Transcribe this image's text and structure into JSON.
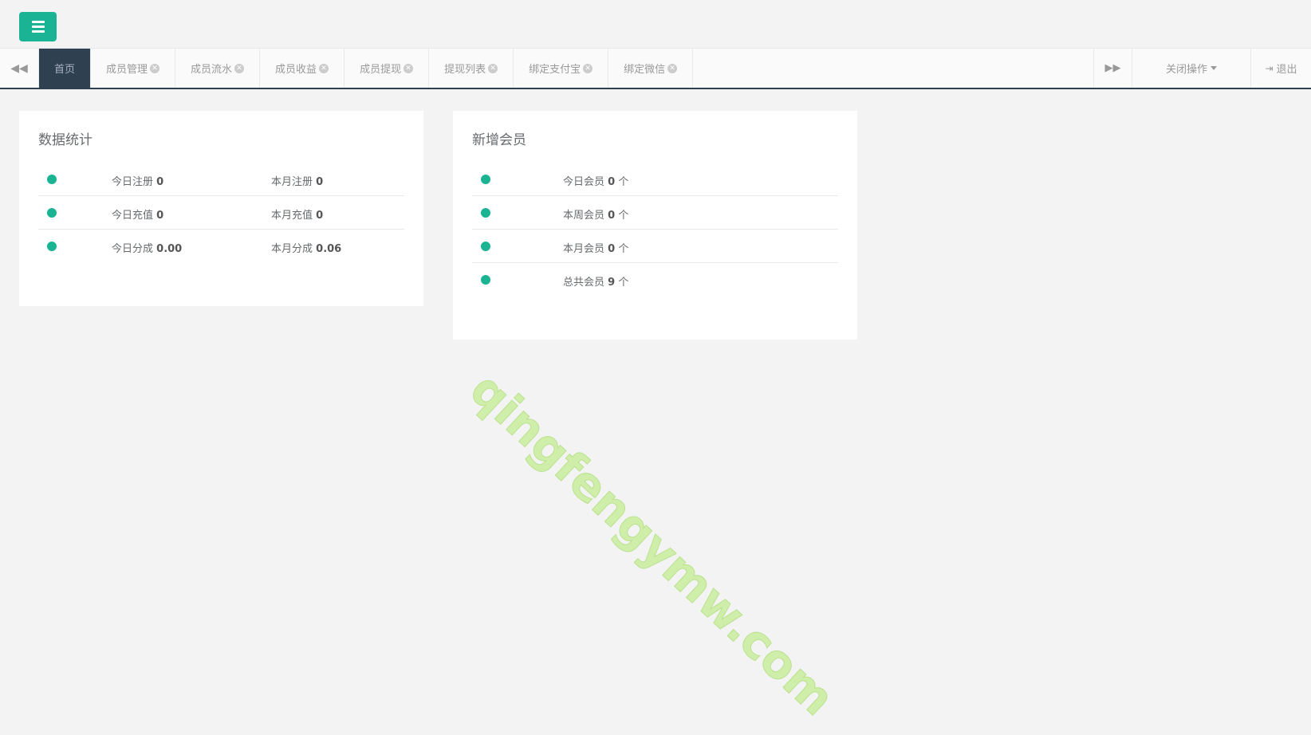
{
  "header": {
    "menu_toggle_icon": "hamburger-menu-icon"
  },
  "tabbar": {
    "nav_back_icon": "double-chevron-left-icon",
    "nav_forward_icon": "double-chevron-right-icon",
    "tabs": [
      {
        "label": "首页",
        "active": true
      },
      {
        "label": "成员管理",
        "active": false
      },
      {
        "label": "成员流水",
        "active": false
      },
      {
        "label": "成员收益",
        "active": false
      },
      {
        "label": "成员提现",
        "active": false
      },
      {
        "label": "提现列表",
        "active": false
      },
      {
        "label": "绑定支付宝",
        "active": false
      },
      {
        "label": "绑定微信",
        "active": false
      }
    ],
    "close_ops_label": "关闭操作",
    "logout_label": "退出"
  },
  "stats_panel": {
    "title": "数据统计",
    "rows": [
      {
        "left_label": "今日注册",
        "left_value": "0",
        "right_label": "本月注册",
        "right_value": "0"
      },
      {
        "left_label": "今日充值",
        "left_value": "0",
        "right_label": "本月充值",
        "right_value": "0"
      },
      {
        "left_label": "今日分成",
        "left_value": "0.00",
        "right_label": "本月分成",
        "right_value": "0.06"
      }
    ]
  },
  "members_panel": {
    "title": "新增会员",
    "rows": [
      {
        "label": "今日会员",
        "value": "0",
        "unit": "个"
      },
      {
        "label": "本周会员",
        "value": "0",
        "unit": "个"
      },
      {
        "label": "本月会员",
        "value": "0",
        "unit": "个"
      },
      {
        "label": "总共会员",
        "value": "9",
        "unit": "个"
      }
    ]
  },
  "watermark": "qingfengymw.com",
  "colors": {
    "accent": "#1ab394",
    "nav_dark": "#2f4050",
    "background": "#f3f3f4"
  }
}
